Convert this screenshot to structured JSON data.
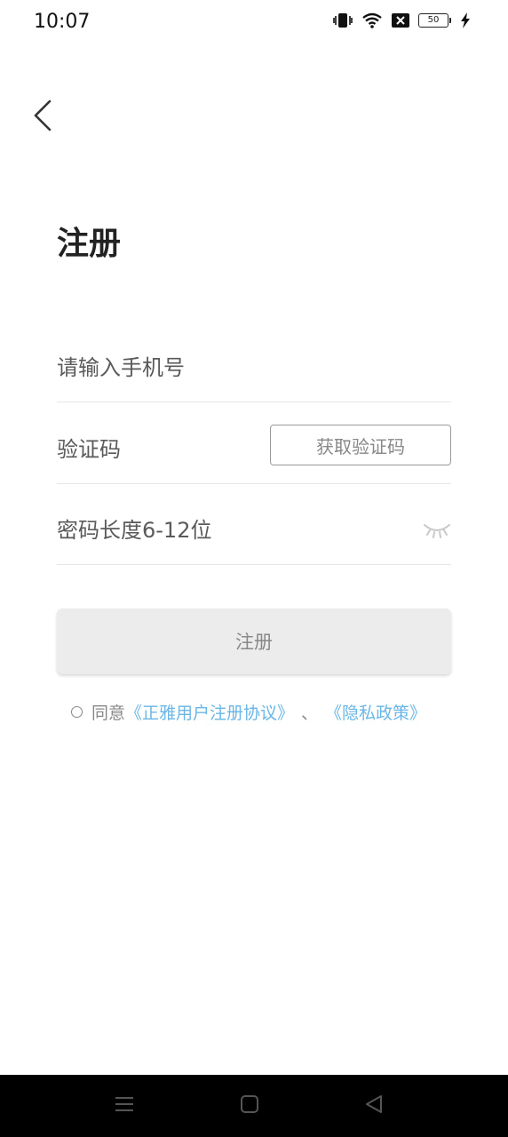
{
  "status_bar": {
    "time": "10:07",
    "battery": "50",
    "icons": [
      "vibrate-icon",
      "wifi-icon",
      "sim-off-icon",
      "battery-icon",
      "charging-icon"
    ]
  },
  "header": {
    "back_icon": "chevron-left-icon"
  },
  "page": {
    "title": "注册"
  },
  "form": {
    "phone": {
      "value": "",
      "placeholder": "请输入手机号"
    },
    "code": {
      "value": "",
      "placeholder": "验证码",
      "get_code_label": "获取验证码"
    },
    "password": {
      "value": "",
      "placeholder": "密码长度6-12位",
      "toggle_icon": "eye-closed-icon"
    },
    "submit_label": "注册"
  },
  "agreement": {
    "prefix": "同意",
    "terms_link": "《正雅用户注册协议》",
    "separator": "、",
    "privacy_link": "《隐私政策》"
  },
  "nav_bar": {
    "icons": [
      "menu-icon",
      "home-icon",
      "back-icon"
    ]
  },
  "colors": {
    "link": "#6ab6e6",
    "button_bg": "#ececec",
    "nav_bg": "#000000",
    "divider": "#e6e6e6"
  }
}
